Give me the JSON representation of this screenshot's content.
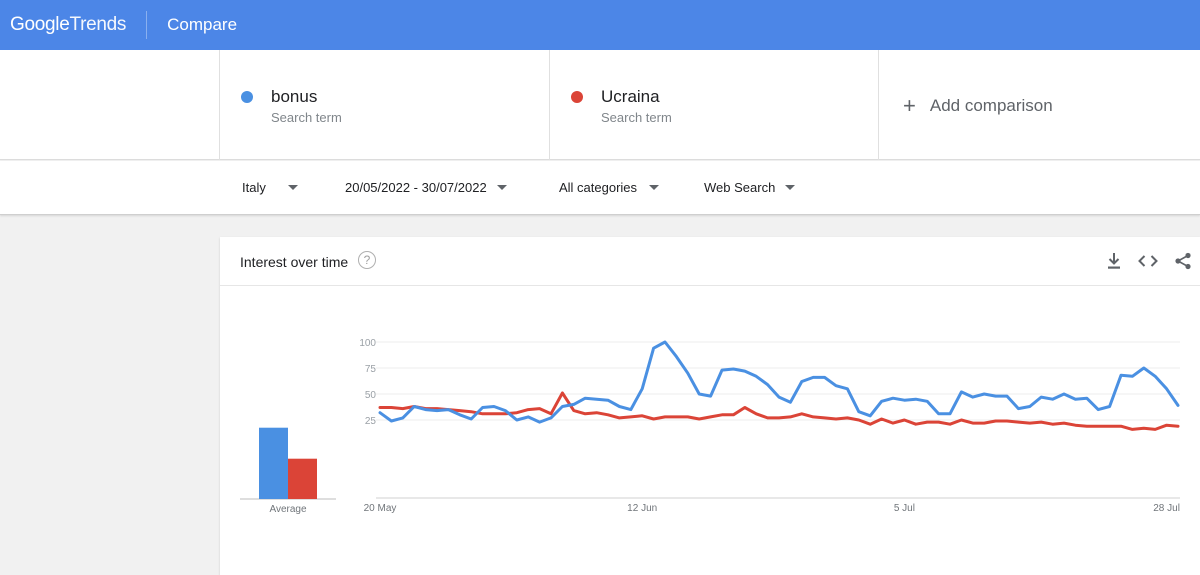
{
  "header": {
    "logo_google": "Google",
    "logo_trends": "Trends",
    "title": "Compare"
  },
  "terms": [
    {
      "name": "bonus",
      "sub": "Search term",
      "color": "#4a90e2"
    },
    {
      "name": "Ucraina",
      "sub": "Search term",
      "color": "#db4437"
    }
  ],
  "add_comparison": "Add comparison",
  "filters": {
    "region": "Italy",
    "date_range": "20/05/2022 - 30/07/2022",
    "category": "All categories",
    "search_type": "Web Search"
  },
  "card": {
    "title": "Interest over time",
    "help": "?",
    "icons": [
      "download-icon",
      "embed-icon",
      "share-icon"
    ]
  },
  "chart_data": {
    "type": "line",
    "ylim": [
      0,
      100
    ],
    "yticks": [
      "100",
      "75",
      "50",
      "25"
    ],
    "xticks": [
      "20 May",
      "12 Jun",
      "5 Jul",
      "28 Jul"
    ],
    "xtick_index": [
      0,
      23,
      46,
      69
    ],
    "average_label": "Average",
    "averages": [
      46,
      26
    ],
    "grid": true,
    "series": [
      {
        "name": "bonus",
        "color": "#4a90e2",
        "values": [
          32,
          24,
          27,
          38,
          35,
          34,
          35,
          30,
          26,
          37,
          38,
          34,
          25,
          28,
          23,
          27,
          38,
          40,
          46,
          45,
          44,
          38,
          35,
          55,
          94,
          100,
          86,
          70,
          50,
          48,
          73,
          74,
          72,
          67,
          59,
          47,
          42,
          62,
          66,
          66,
          58,
          55,
          33,
          29,
          43,
          46,
          44,
          45,
          43,
          31,
          31,
          52,
          47,
          50,
          48,
          48,
          36,
          38,
          47,
          45,
          50,
          45,
          46,
          35,
          38,
          68,
          67,
          75,
          67,
          55,
          39
        ]
      },
      {
        "name": "Ucraina",
        "color": "#db4437",
        "values": [
          37,
          37,
          36,
          38,
          36,
          36,
          35,
          34,
          33,
          31,
          31,
          31,
          32,
          35,
          36,
          31,
          51,
          34,
          31,
          32,
          30,
          27,
          28,
          29,
          26,
          28,
          28,
          28,
          26,
          28,
          30,
          30,
          37,
          31,
          27,
          27,
          28,
          31,
          28,
          27,
          26,
          27,
          25,
          21,
          26,
          22,
          25,
          21,
          23,
          23,
          21,
          25,
          22,
          22,
          24,
          24,
          23,
          22,
          23,
          21,
          22,
          20,
          19,
          19,
          19,
          19,
          16,
          17,
          16,
          20,
          19
        ]
      }
    ]
  }
}
